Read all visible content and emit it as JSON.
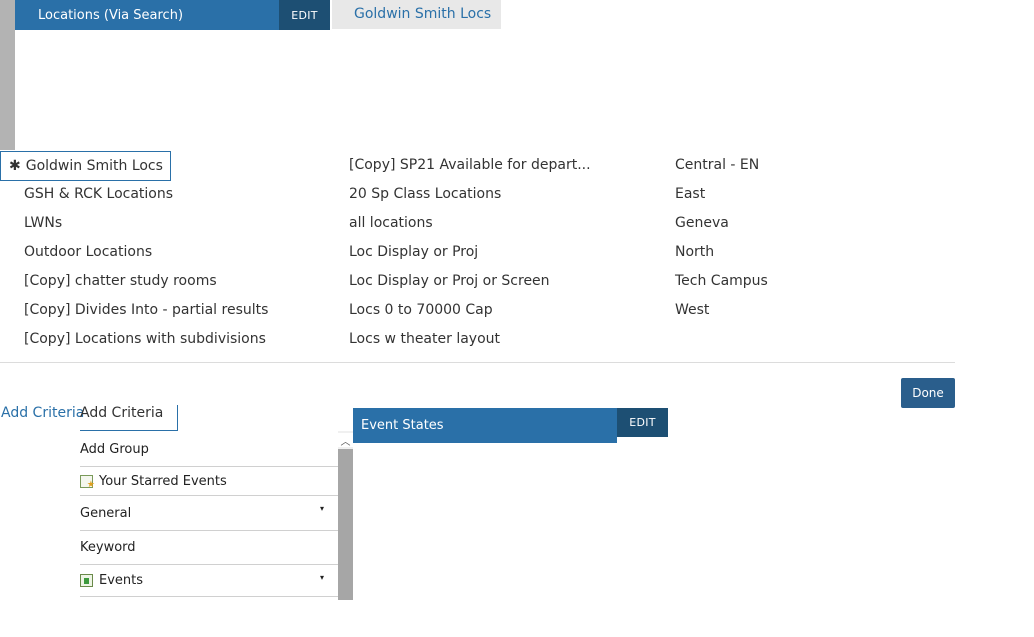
{
  "locations_panel": {
    "header_title": "Locations (Via Search)",
    "edit_label": "EDIT",
    "selected_value": "Goldwin Smith Locs",
    "active_marker": "✱",
    "columns": [
      [
        "Goldwin Smith Locs",
        "GSH & RCK Locations",
        "LWNs",
        "Outdoor Locations",
        "[Copy] chatter study rooms",
        "[Copy] Divides Into - partial results",
        "[Copy] Locations with subdivisions"
      ],
      [
        "[Copy] SP21 Available for depart...",
        "20 Sp Class Locations",
        "all locations",
        "Loc Display or Proj",
        "Loc Display or Proj or Screen",
        "Locs 0 to 70000 Cap",
        "Locs w theater layout"
      ],
      [
        "Central - EN",
        "East",
        "Geneva",
        "North",
        "Tech Campus",
        "West"
      ]
    ]
  },
  "done_label": "Done",
  "add_criteria": {
    "link_label": "Add Criteria",
    "tab_label": "Add Criteria",
    "scroll_up_glyph": "︿",
    "items": [
      {
        "label": "Add Group"
      },
      {
        "label": "Your Starred Events",
        "icon": "starred-events-icon"
      },
      {
        "label": "General",
        "caret": "▾"
      },
      {
        "label": "Keyword"
      },
      {
        "label": "Events",
        "icon": "events-icon",
        "caret": "▾"
      }
    ]
  },
  "event_states_panel": {
    "header_title": "Event States",
    "edit_label": "EDIT"
  },
  "colors": {
    "accent": "#2a70a8",
    "edit_bg": "#1d4f73",
    "done_bg": "#2a5e8c"
  }
}
